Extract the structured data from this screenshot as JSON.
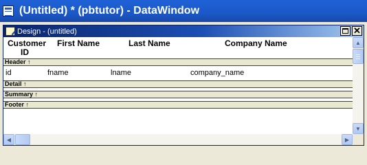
{
  "window": {
    "title": "(Untitled) * (pbtutor) - DataWindow"
  },
  "child_window": {
    "title": "Design - (untitled)"
  },
  "header_columns": {
    "customer_id_line1": "Customer",
    "customer_id_line2": "ID",
    "first_name": "First Name",
    "last_name": "Last Name",
    "company_name": "Company Name"
  },
  "bands": {
    "header": "Header ↑",
    "detail": "Detail ↑",
    "summary": "Summary ↑",
    "footer": "Footer ↑"
  },
  "detail_fields": {
    "id": "id",
    "fname": "fname",
    "lname": "lname",
    "company_name": "company_name"
  },
  "icons": {
    "app": "datawindow-app-icon",
    "doc": "design-doc-icon",
    "restore": "restore-icon",
    "close": "close-icon",
    "scroll_up": "arrow-up-icon",
    "scroll_down": "arrow-down-icon",
    "scroll_left": "arrow-left-icon",
    "scroll_right": "arrow-right-icon"
  },
  "colors": {
    "title_bar": "#1b58c8",
    "band": "#e8e7d0",
    "scrollbar": "#b3c9f2"
  }
}
